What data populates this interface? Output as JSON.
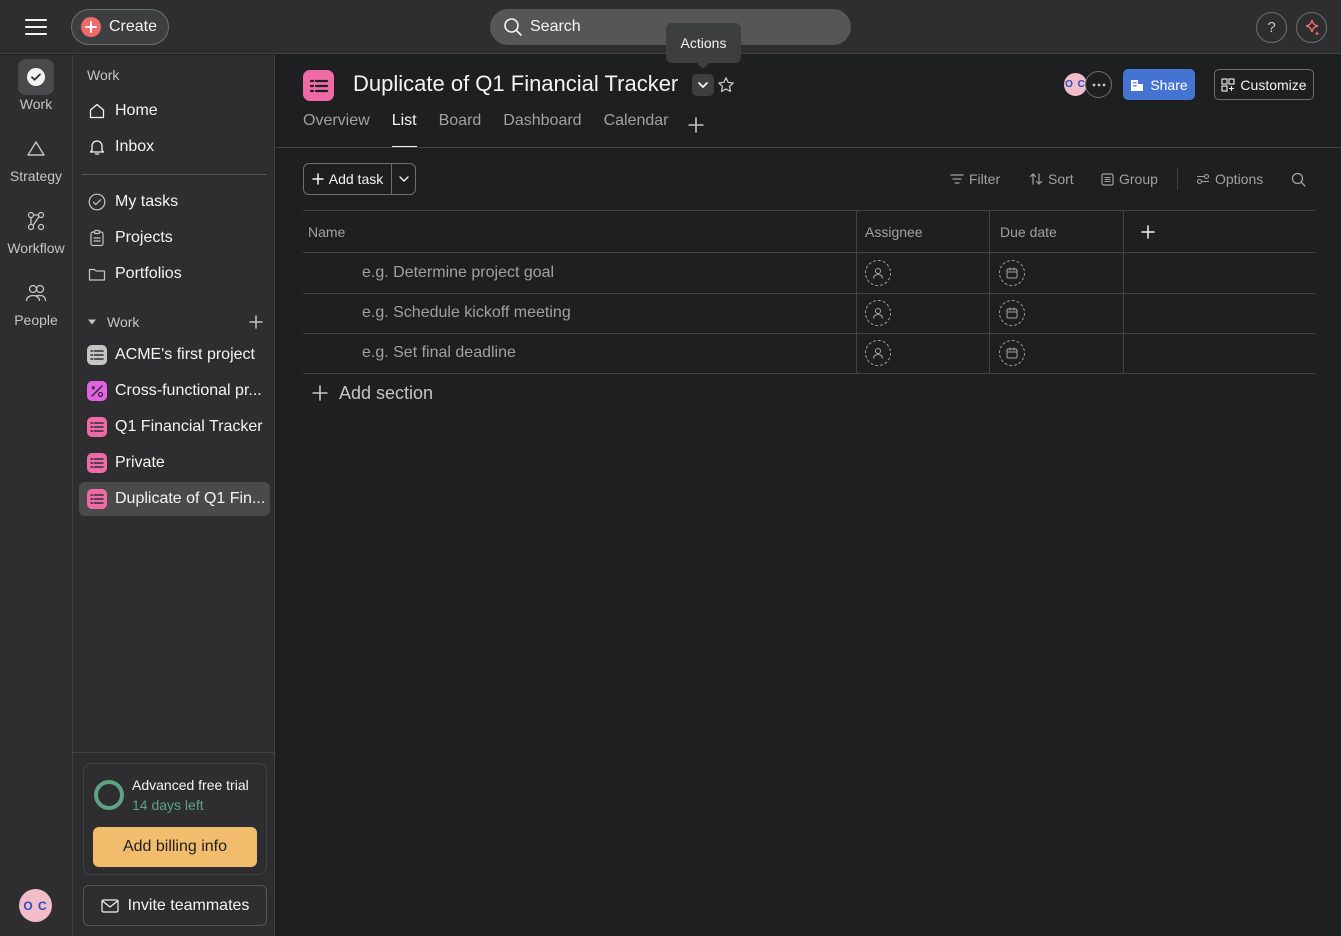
{
  "topbar": {
    "create_label": "Create",
    "search_label": "Search",
    "help_label": "?"
  },
  "rail": {
    "items": [
      {
        "label": "Work",
        "icon": "check-circle-icon"
      },
      {
        "label": "Strategy",
        "icon": "triangle-icon"
      },
      {
        "label": "Workflow",
        "icon": "workflow-icon"
      },
      {
        "label": "People",
        "icon": "people-icon"
      }
    ],
    "avatar_initials": "O C"
  },
  "sidebar": {
    "heading": "Work",
    "nav": [
      {
        "label": "Home",
        "icon": "home-icon"
      },
      {
        "label": "Inbox",
        "icon": "bell-icon"
      }
    ],
    "nav2": [
      {
        "label": "My tasks",
        "icon": "check-circle-icon"
      },
      {
        "label": "Projects",
        "icon": "clipboard-icon"
      },
      {
        "label": "Portfolios",
        "icon": "folder-icon"
      }
    ],
    "section_label": "Work",
    "projects": [
      {
        "label": "ACME's first project",
        "color": "#c7c4c4",
        "icon": "list-icon"
      },
      {
        "label": "Cross-functional pr...",
        "color": "#e362e3",
        "icon": "percent-icon"
      },
      {
        "label": "Q1 Financial Tracker",
        "color": "#f06aa6",
        "icon": "list-icon"
      },
      {
        "label": "Private",
        "color": "#f06aa6",
        "icon": "list-icon"
      },
      {
        "label": "Duplicate of Q1 Fin...",
        "color": "#f06aa6",
        "icon": "list-icon"
      }
    ],
    "trial": {
      "title": "Advanced free trial",
      "subtitle": "14 days left",
      "billing_label": "Add billing info"
    },
    "invite_label": "Invite teammates"
  },
  "project": {
    "title": "Duplicate of Q1 Financial Tracker",
    "tooltip": "Actions",
    "member_initials": "O C",
    "share_label": "Share",
    "customize_label": "Customize",
    "tabs": [
      "Overview",
      "List",
      "Board",
      "Dashboard",
      "Calendar"
    ],
    "active_tab": "List"
  },
  "toolbar": {
    "add_task_label": "Add task",
    "filter_label": "Filter",
    "sort_label": "Sort",
    "group_label": "Group",
    "options_label": "Options"
  },
  "table": {
    "columns": [
      "Name",
      "Assignee",
      "Due date"
    ],
    "rows": [
      {
        "name": "e.g. Determine project goal"
      },
      {
        "name": "e.g. Schedule kickoff meeting"
      },
      {
        "name": "e.g. Set final deadline"
      }
    ],
    "add_section_label": "Add section"
  },
  "colors": {
    "accent_blue": "#4573d2",
    "billing_orange": "#f1bd6c",
    "trial_green": "#5da283",
    "project_pink": "#f06aa6",
    "create_red": "#f06a6a"
  }
}
